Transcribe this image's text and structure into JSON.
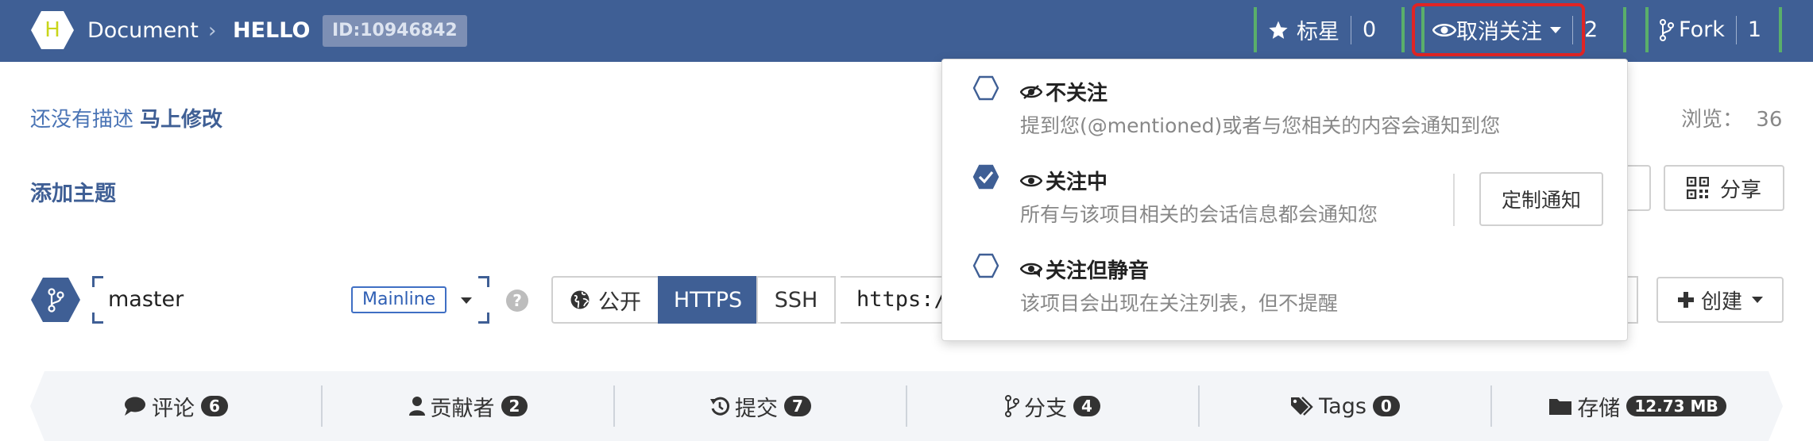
{
  "header": {
    "avatar_letter": "H",
    "breadcrumb_owner": "Document",
    "breadcrumb_sep": "›",
    "breadcrumb_repo": "HELLO",
    "repo_id": "ID:10946842",
    "star": {
      "label": "标星",
      "count": "0",
      "icon": "star-icon"
    },
    "watch": {
      "label": "取消关注",
      "count": "2",
      "icon": "eye-icon"
    },
    "fork": {
      "label": "Fork",
      "count": "1",
      "icon": "fork-icon"
    }
  },
  "description": {
    "empty_text": "还没有描述",
    "edit_link": "马上修改"
  },
  "views": {
    "label": "浏览：",
    "count": "36"
  },
  "topics": {
    "add_label": "添加主题"
  },
  "actions": {
    "share_label": "分享",
    "create_label": "创建"
  },
  "branch": {
    "name": "master",
    "tag": "Mainline",
    "help": "?"
  },
  "clone": {
    "public_label": "公开",
    "https_label": "HTTPS",
    "ssh_label": "SSH",
    "url_value": "https:/"
  },
  "stats": [
    {
      "icon": "comment-icon",
      "label": "评论",
      "count": "6"
    },
    {
      "icon": "user-icon",
      "label": "贡献者",
      "count": "2"
    },
    {
      "icon": "history-icon",
      "label": "提交",
      "count": "7"
    },
    {
      "icon": "branch-icon",
      "label": "分支",
      "count": "4"
    },
    {
      "icon": "tags-icon",
      "label": "Tags",
      "count": "0"
    },
    {
      "icon": "folder-icon",
      "label": "存储",
      "count": "12.73 MB"
    }
  ],
  "watch_menu": {
    "items": [
      {
        "title": "不关注",
        "desc": "提到您(@mentioned)或者与您相关的内容会通知到您",
        "selected": false
      },
      {
        "title": "关注中",
        "desc": "所有与该项目相关的会话信息都会通知您",
        "selected": true
      },
      {
        "title": "关注但静音",
        "desc": "该项目会出现在关注列表，但不提醒",
        "selected": false
      }
    ],
    "custom_label": "定制通知"
  },
  "colors": {
    "brand": "#3f5f95",
    "accent_green": "#5aaf6a",
    "highlight_red": "#e02424"
  }
}
